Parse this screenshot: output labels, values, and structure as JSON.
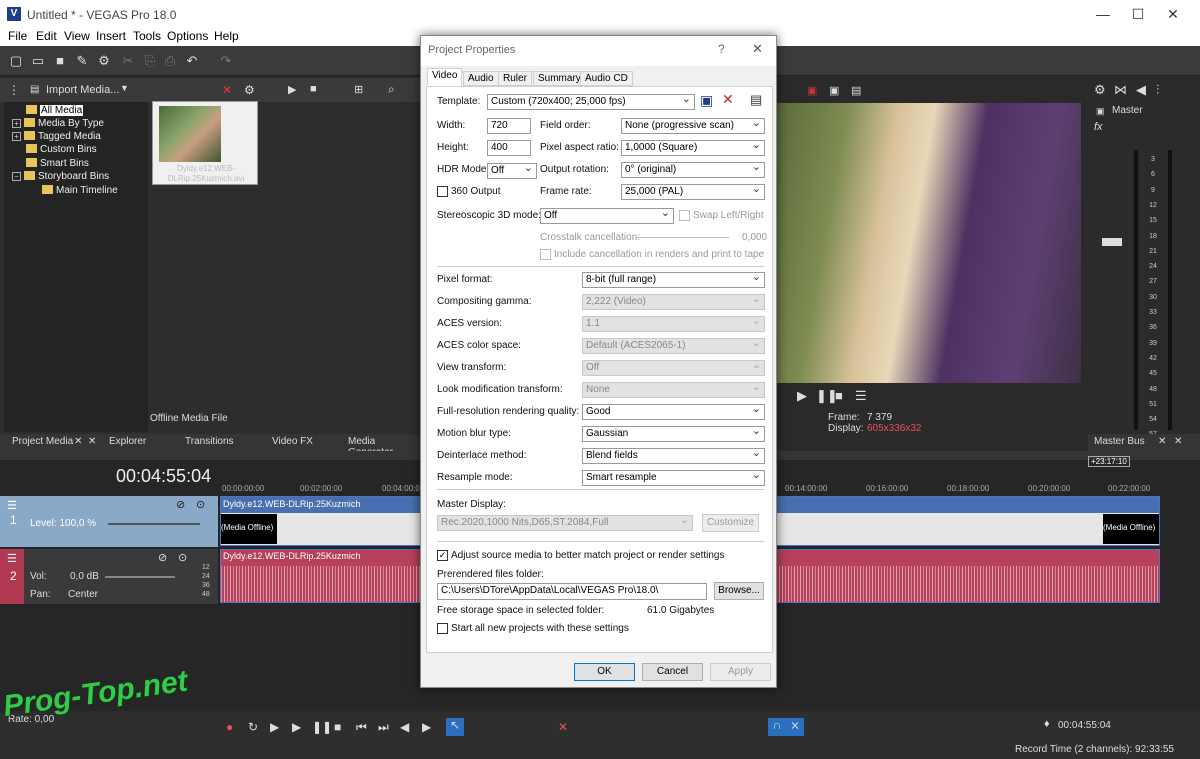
{
  "window": {
    "title": "Untitled * - VEGAS Pro 18.0"
  },
  "menu": [
    "File",
    "Edit",
    "View",
    "Insert",
    "Tools",
    "Options",
    "Help"
  ],
  "media_panel": {
    "import_label": "Import Media...",
    "tree": [
      "All Media",
      "Media By Type",
      "Tagged Media",
      "Custom Bins",
      "Smart Bins",
      "Storyboard Bins",
      "Main Timeline"
    ],
    "file_name": "Dyldy.e12.WEB-DLRip.25Kuzmich.avi",
    "status": "Offline Media File",
    "tabs": [
      "Project Media",
      "Explorer",
      "Transitions",
      "Video FX",
      "Media Generator"
    ]
  },
  "preview": {
    "frame_label": "Frame:",
    "frame_value": "7 379",
    "display_label": "Display:",
    "display_value": "605x336x32"
  },
  "mixer": {
    "master_label": "Master",
    "bus_tab": "Master Bus",
    "scale": [
      "3",
      "6",
      "9",
      "12",
      "15",
      "18",
      "21",
      "24",
      "27",
      "30",
      "33",
      "36",
      "39",
      "42",
      "45",
      "48",
      "51",
      "54",
      "57"
    ]
  },
  "timeline": {
    "time": "00:04:55:04",
    "ruler": [
      "00:00:00:00",
      "00:02:00:00",
      "00:04:00:00",
      "00:14:00:00",
      "00:16:00:00",
      "00:18:00:00",
      "00:20:00:00",
      "00:22:00:00"
    ],
    "marker": "+23:17:10",
    "video_track": {
      "number": "1",
      "level": "Level: 100,0 %",
      "clip": "Dyldy.e12.WEB-DLRip.25Kuzmich",
      "offline": "(Media Offline)"
    },
    "audio_track": {
      "number": "2",
      "vol_label": "Vol:",
      "vol_value": "0,0 dB",
      "pan_label": "Pan:",
      "pan_value": "Center",
      "clip": "Dyldy.e12.WEB-DLRip.25Kuzmich",
      "db": [
        "12",
        "24",
        "36",
        "48"
      ]
    }
  },
  "transport": {
    "rate": "Rate: 0,00",
    "time": "00:04:55:04",
    "record_time": "Record Time (2 channels): 92:33:55"
  },
  "watermark": "Prog-Top.net",
  "dialog": {
    "title": "Project Properties",
    "help": "?",
    "close": "✕",
    "tabs": [
      "Video",
      "Audio",
      "Ruler",
      "Summary",
      "Audio CD"
    ],
    "template_label": "Template:",
    "template_value": "Custom (720x400; 25,000 fps)",
    "width_label": "Width:",
    "width_value": "720",
    "height_label": "Height:",
    "height_value": "400",
    "field_order_label": "Field order:",
    "field_order_value": "None (progressive scan)",
    "par_label": "Pixel aspect ratio:",
    "par_value": "1,0000 (Square)",
    "hdr_label": "HDR Mode:",
    "hdr_value": "Off",
    "rotation_label": "Output rotation:",
    "rotation_value": "0° (original)",
    "output360_label": "360 Output",
    "framerate_label": "Frame rate:",
    "framerate_value": "25,000 (PAL)",
    "stereo_label": "Stereoscopic 3D mode:",
    "stereo_value": "Off",
    "swap_label": "Swap Left/Right",
    "crosstalk_label": "Crosstalk cancellation:",
    "crosstalk_value": "0,000",
    "include_cancel_label": "Include cancellation in renders and print to tape",
    "rows": [
      {
        "label": "Pixel format:",
        "value": "8-bit (full range)",
        "enabled": true
      },
      {
        "label": "Compositing gamma:",
        "value": "2,222 (Video)",
        "enabled": false
      },
      {
        "label": "ACES version:",
        "value": "1.1",
        "enabled": false
      },
      {
        "label": "ACES color space:",
        "value": "Default (ACES2065-1)",
        "enabled": false
      },
      {
        "label": "View transform:",
        "value": "Off",
        "enabled": false
      },
      {
        "label": "Look modification transform:",
        "value": "None",
        "enabled": false
      },
      {
        "label": "Full-resolution rendering quality:",
        "value": "Good",
        "enabled": true
      },
      {
        "label": "Motion blur type:",
        "value": "Gaussian",
        "enabled": true
      },
      {
        "label": "Deinterlace method:",
        "value": "Blend fields",
        "enabled": true
      },
      {
        "label": "Resample mode:",
        "value": "Smart resample",
        "enabled": true
      }
    ],
    "master_display_label": "Master Display:",
    "master_display_value": "Rec.2020,1000 Nits,D65,ST.2084,Full",
    "customize_label": "Customize",
    "adjust_label": "Adjust source media to better match project or render settings",
    "prerender_label": "Prerendered files folder:",
    "prerender_value": "C:\\Users\\DTore\\AppData\\Local\\VEGAS Pro\\18.0\\",
    "browse_label": "Browse...",
    "free_label": "Free storage space in selected folder:",
    "free_value": "61.0 Gigabytes",
    "start_all_label": "Start all new projects with these settings",
    "ok_label": "OK",
    "cancel_label": "Cancel",
    "apply_label": "Apply"
  }
}
